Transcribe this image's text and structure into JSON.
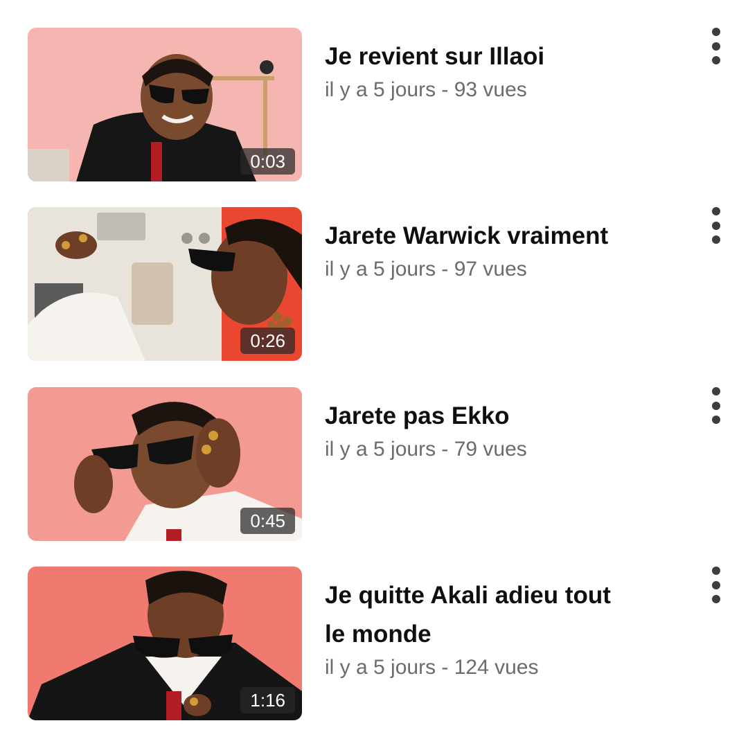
{
  "videos": [
    {
      "title": "Je revient sur Illaoi",
      "meta": "il y a 5 jours - 93 vues",
      "duration": "0:03",
      "thumbnail_bg": "#f3aaa6"
    },
    {
      "title": "Jarete Warwick vraiment",
      "meta": "il y a 5 jours - 97 vues",
      "duration": "0:26",
      "thumbnail_bg": "#e9472f"
    },
    {
      "title": "Jarete pas Ekko",
      "meta": "il y a 5 jours - 79 vues",
      "duration": "0:45",
      "thumbnail_bg": "#f39a93"
    },
    {
      "title": "Je quitte Akali adieu tout le monde",
      "meta": "il y a 5 jours - 124 vues",
      "duration": "1:16",
      "thumbnail_bg": "#f07a70"
    }
  ],
  "icons": {
    "more": "more-vertical-icon"
  }
}
